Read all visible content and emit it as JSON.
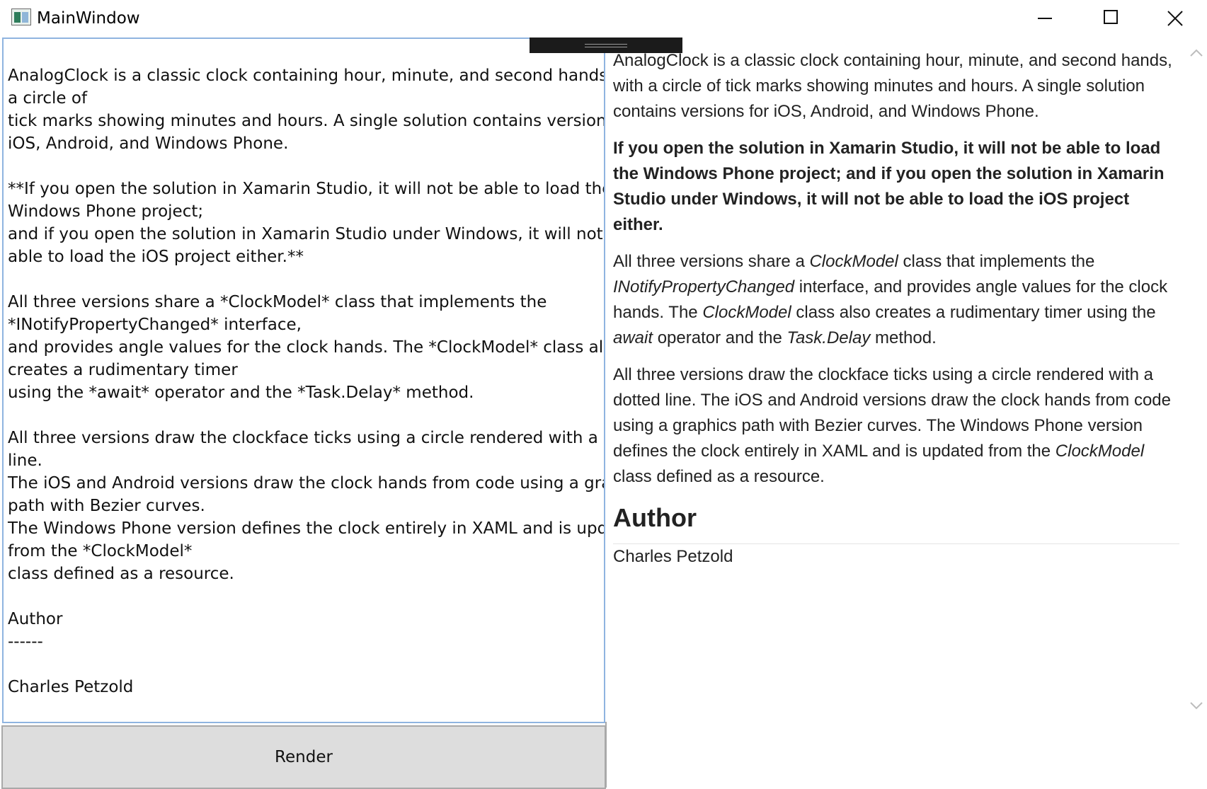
{
  "window": {
    "title": "MainWindow",
    "icon": "app-window-icon",
    "controls": [
      "minimize-icon",
      "maximize-icon",
      "close-icon"
    ]
  },
  "editor": {
    "text": "AnalogClock is a classic clock containing hour, minute, and second hands, with\na circle of\ntick marks showing minutes and hours. A single solution contains versions for\niOS, Android, and Windows Phone.\n\n**If you open the solution in Xamarin Studio, it will not be able to load the\nWindows Phone project;\nand if you open the solution in Xamarin Studio under Windows, it will not be\nable to load the iOS project either.**\n\nAll three versions share a *ClockModel* class that implements the\n*INotifyPropertyChanged* interface,\nand provides angle values for the clock hands. The *ClockModel* class also\ncreates a rudimentary timer\nusing the *await* operator and the *Task.Delay* method.\n\nAll three versions draw the clockface ticks using a circle rendered with a dotted\nline.\nThe iOS and Android versions draw the clock hands from code using a graphics\npath with Bezier curves.\nThe Windows Phone version defines the clock entirely in XAML and is updated\nfrom the *ClockModel*\nclass defined as a resource.\n\nAuthor\n------\n\nCharles Petzold"
  },
  "render_button": {
    "label": "Render"
  },
  "preview": {
    "p1": "AnalogClock is a classic clock containing hour, minute, and second hands, with a circle of tick marks showing minutes and hours. A single solution contains versions for iOS, Android, and Windows Phone.",
    "p2_bold": "If you open the solution in Xamarin Studio, it will not be able to load the Windows Phone project; and if you open the solution in Xamarin Studio under Windows, it will not be able to load the iOS project either.",
    "p3": {
      "t1": "All three versions share a ",
      "em1": "ClockModel",
      "t2": " class that implements the ",
      "em2": "INotifyPropertyChanged",
      "t3": " interface, and provides angle values for the clock hands. The ",
      "em3": "ClockModel",
      "t4": " class also creates a rudimentary timer using the ",
      "em4": "await",
      "t5": " operator and the ",
      "em5": "Task.Delay",
      "t6": " method."
    },
    "p4": {
      "t1": "All three versions draw the clockface ticks using a circle rendered with a dotted line. The iOS and Android versions draw the clock hands from code using a graphics path with Bezier curves. The Windows Phone version defines the clock entirely in XAML and is updated from the ",
      "em1": "ClockModel",
      "t2": " class defined as a resource."
    },
    "author_heading": "Author",
    "author_name": "Charles Petzold"
  },
  "scrollbar": {
    "up_icon": "chevron-up-icon",
    "down_icon": "chevron-down-icon"
  }
}
